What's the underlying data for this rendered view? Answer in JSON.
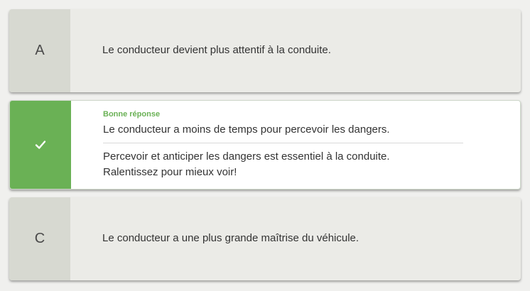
{
  "answers": [
    {
      "letter": "A",
      "text": "Le conducteur devient plus attentif à la conduite."
    },
    {
      "letter": "",
      "badge": "Bonne réponse",
      "text": "Le conducteur a moins de temps pour percevoir les dangers.",
      "explanation_line1": "Percevoir et anticiper les dangers est essentiel à la conduite.",
      "explanation_line2": "Ralentissez pour mieux voir!"
    },
    {
      "letter": "C",
      "text": "Le conducteur a une plus grande maîtrise du véhicule."
    }
  ],
  "colors": {
    "correct_accent": "#6ab155",
    "neutral_letter_bg": "#d7d9d1",
    "card_bg": "#ebebe7"
  },
  "icons": {
    "correct_marker": "checkmark-icon"
  }
}
